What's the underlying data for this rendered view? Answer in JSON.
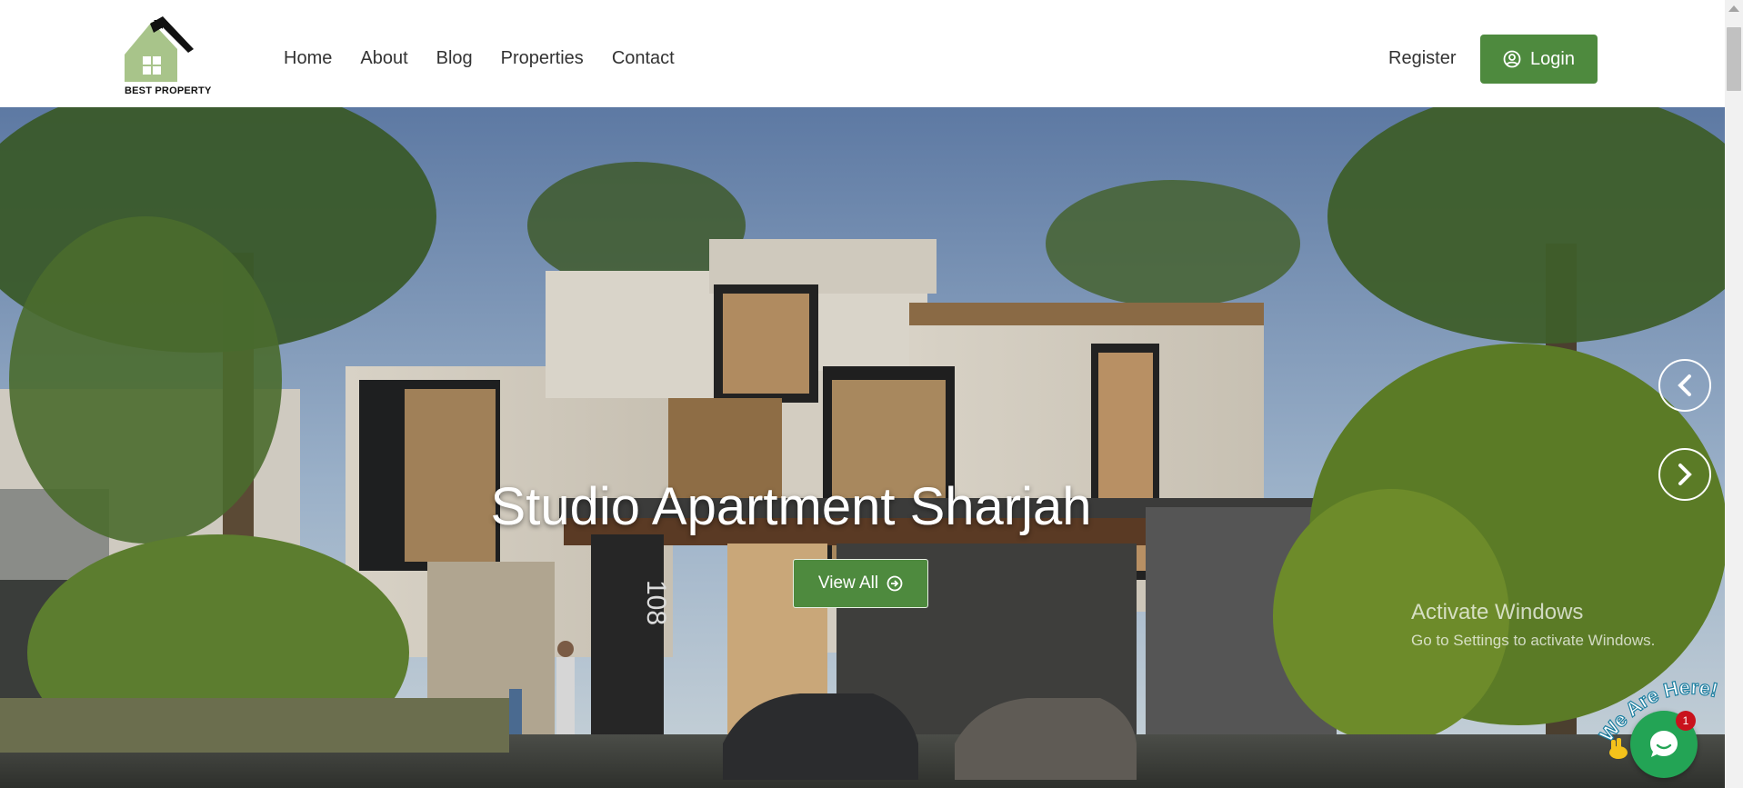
{
  "header": {
    "logo_text": "BEST PROPERTY",
    "nav": [
      "Home",
      "About",
      "Blog",
      "Properties",
      "Contact"
    ],
    "register_label": "Register",
    "login_label": "Login"
  },
  "hero": {
    "title": "Studio Apartment Sharjah",
    "cta_label": "View All",
    "house_number": "108"
  },
  "os_watermark": {
    "title": "Activate Windows",
    "subtitle": "Go to Settings to activate Windows."
  },
  "chat_widget": {
    "banner_text": "We Are Here!",
    "badge_count": "1"
  },
  "colors": {
    "brand_green": "#4e8a3e",
    "logo_green": "#a8c48a",
    "chat_green": "#23a455",
    "badge_red": "#c9121c"
  },
  "icons": [
    "user-circle-icon",
    "arrow-circle-right-icon",
    "chevron-left-icon",
    "chevron-right-icon",
    "chat-bubble-icon",
    "waving-hand-icon"
  ]
}
